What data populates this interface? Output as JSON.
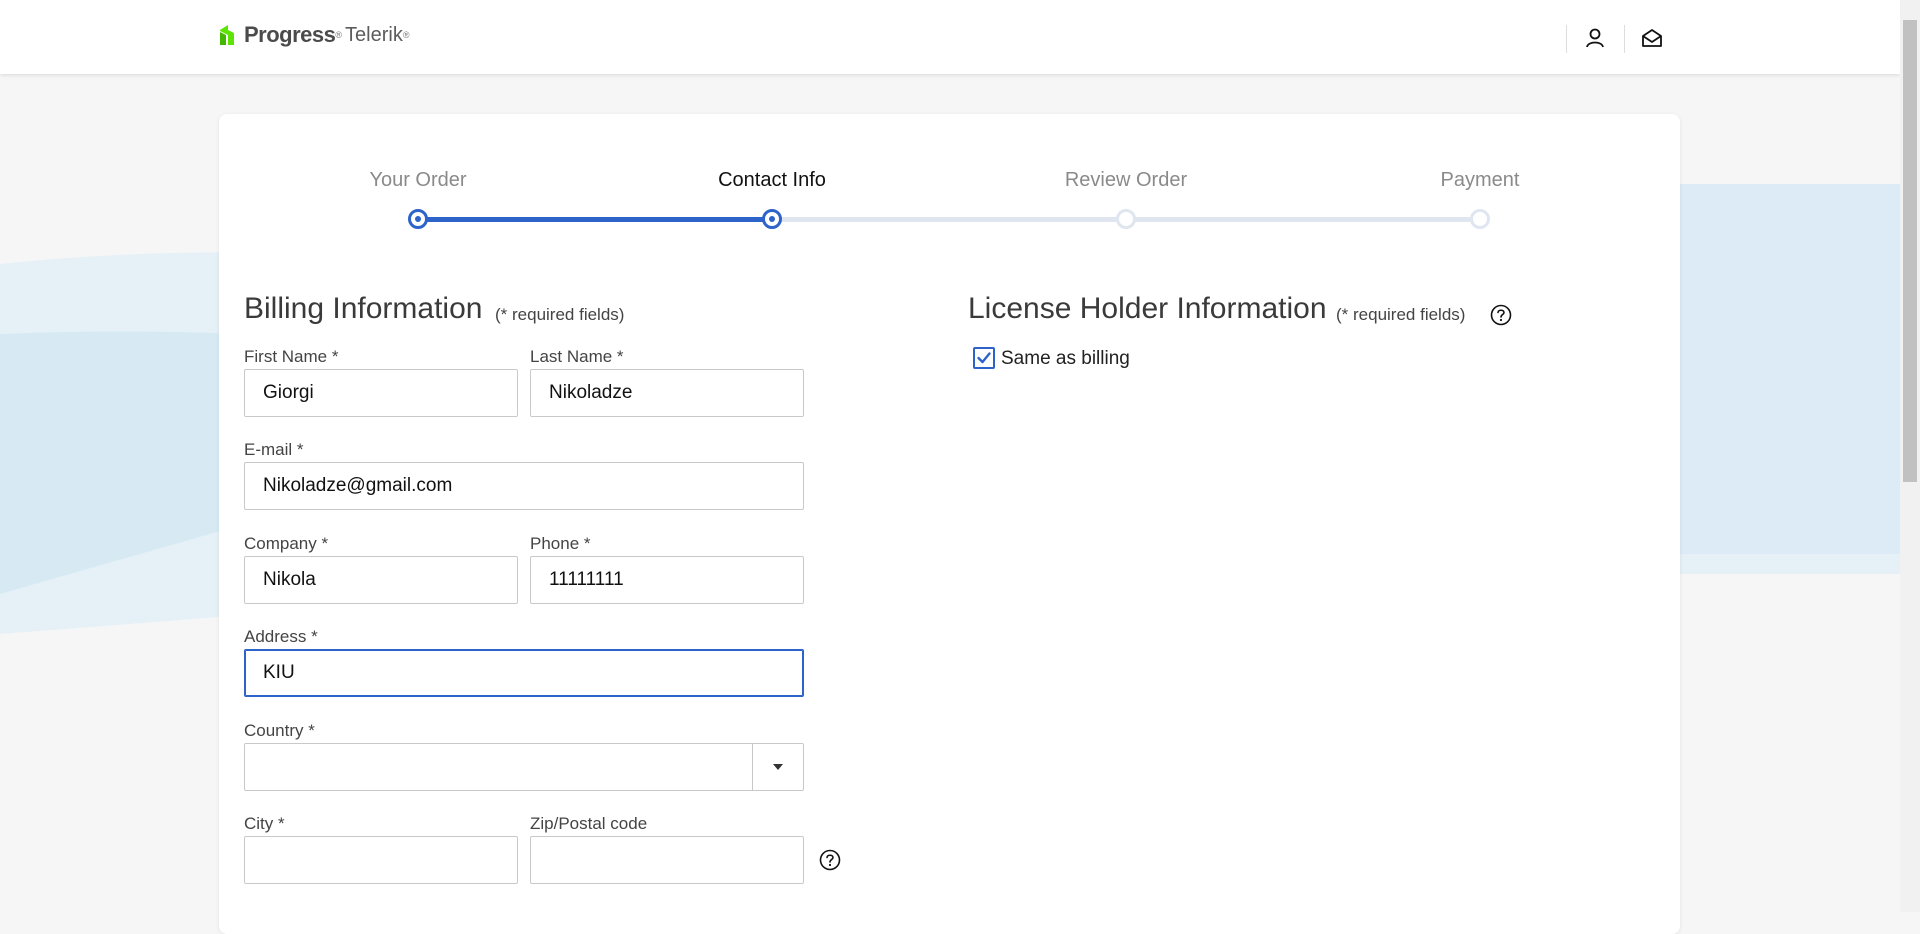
{
  "header": {
    "brand": "Progress",
    "product": "Telerik",
    "trademark": "®",
    "icons": [
      "user-account-icon",
      "envelope-open-icon"
    ]
  },
  "steps": [
    {
      "label": "Your Order",
      "state": "done"
    },
    {
      "label": "Contact Info",
      "state": "active"
    },
    {
      "label": "Review Order",
      "state": "pending"
    },
    {
      "label": "Payment",
      "state": "pending"
    }
  ],
  "billing": {
    "title": "Billing Information",
    "required_note": "(* required fields)",
    "first_name": {
      "label": "First Name *",
      "value": "Giorgi"
    },
    "last_name": {
      "label": "Last Name *",
      "value": "Nikoladze"
    },
    "email": {
      "label": "E-mail *",
      "value": "Nikoladze@gmail.com"
    },
    "company": {
      "label": "Company *",
      "value": "Nikola"
    },
    "phone": {
      "label": "Phone *",
      "value": "11111111"
    },
    "address": {
      "label": "Address *",
      "value": "KIU"
    },
    "country": {
      "label": "Country *",
      "value": ""
    },
    "city": {
      "label": "City *",
      "value": ""
    },
    "zip": {
      "label": "Zip/Postal code",
      "value": ""
    }
  },
  "license": {
    "title": "License Holder Information",
    "required_note": "(* required fields)",
    "same_as_billing": {
      "label": "Same as billing",
      "checked": true
    }
  },
  "colors": {
    "accent": "#2e63c9",
    "brand_green": "#5ce500"
  }
}
